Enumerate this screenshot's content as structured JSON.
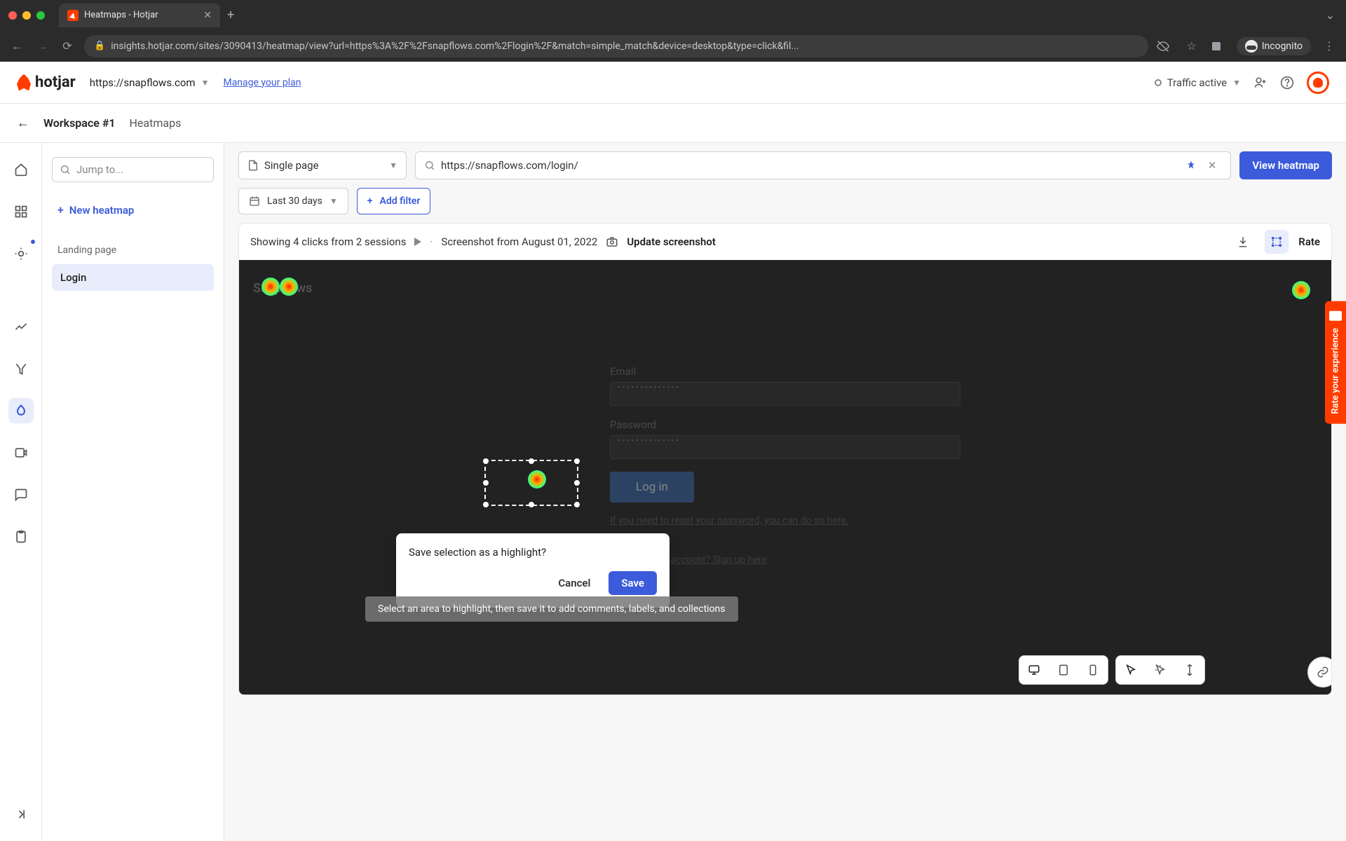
{
  "browser": {
    "tab_title": "Heatmaps - Hotjar",
    "url": "insights.hotjar.com/sites/3090413/heatmap/view?url=https%3A%2F%2Fsnapflows.com%2Flogin%2F&match=simple_match&device=desktop&type=click&fil...",
    "incognito_label": "Incognito"
  },
  "header": {
    "logo_text": "hotjar",
    "site_url": "https://snapflows.com",
    "manage_plan": "Manage your plan",
    "traffic_status": "Traffic active"
  },
  "crumbs": {
    "workspace": "Workspace #1",
    "page": "Heatmaps"
  },
  "sidebar": {
    "search_placeholder": "Jump to...",
    "new_heatmap": "New heatmap",
    "section_label": "Landing page",
    "items": [
      {
        "label": "Login",
        "active": true
      }
    ]
  },
  "filters": {
    "page_mode": "Single page",
    "target_url": "https://snapflows.com/login/",
    "view_button": "View heatmap",
    "date_range": "Last 30 days",
    "add_filter": "Add filter"
  },
  "card": {
    "summary_prefix": "Showing ",
    "summary_clicks": "4 clicks from 2 sessions",
    "screenshot_date": "Screenshot from August 01, 2022",
    "update_label": "Update screenshot",
    "rate_label": "Rate"
  },
  "heatmap_page": {
    "brand": "Snapflows",
    "email_label": "Email",
    "password_label": "Password",
    "dots": "••••••••••••••",
    "login_button": "Log in",
    "reset_text": "If you need to reset your password, you can do so here.",
    "signup_text": "Don't have an account? Sign up here"
  },
  "popup": {
    "title": "Save selection as a highlight?",
    "cancel": "Cancel",
    "save": "Save"
  },
  "hint": "Select an area to highlight, then save it to add comments, labels, and collections",
  "rate_tab": "Rate your experience"
}
